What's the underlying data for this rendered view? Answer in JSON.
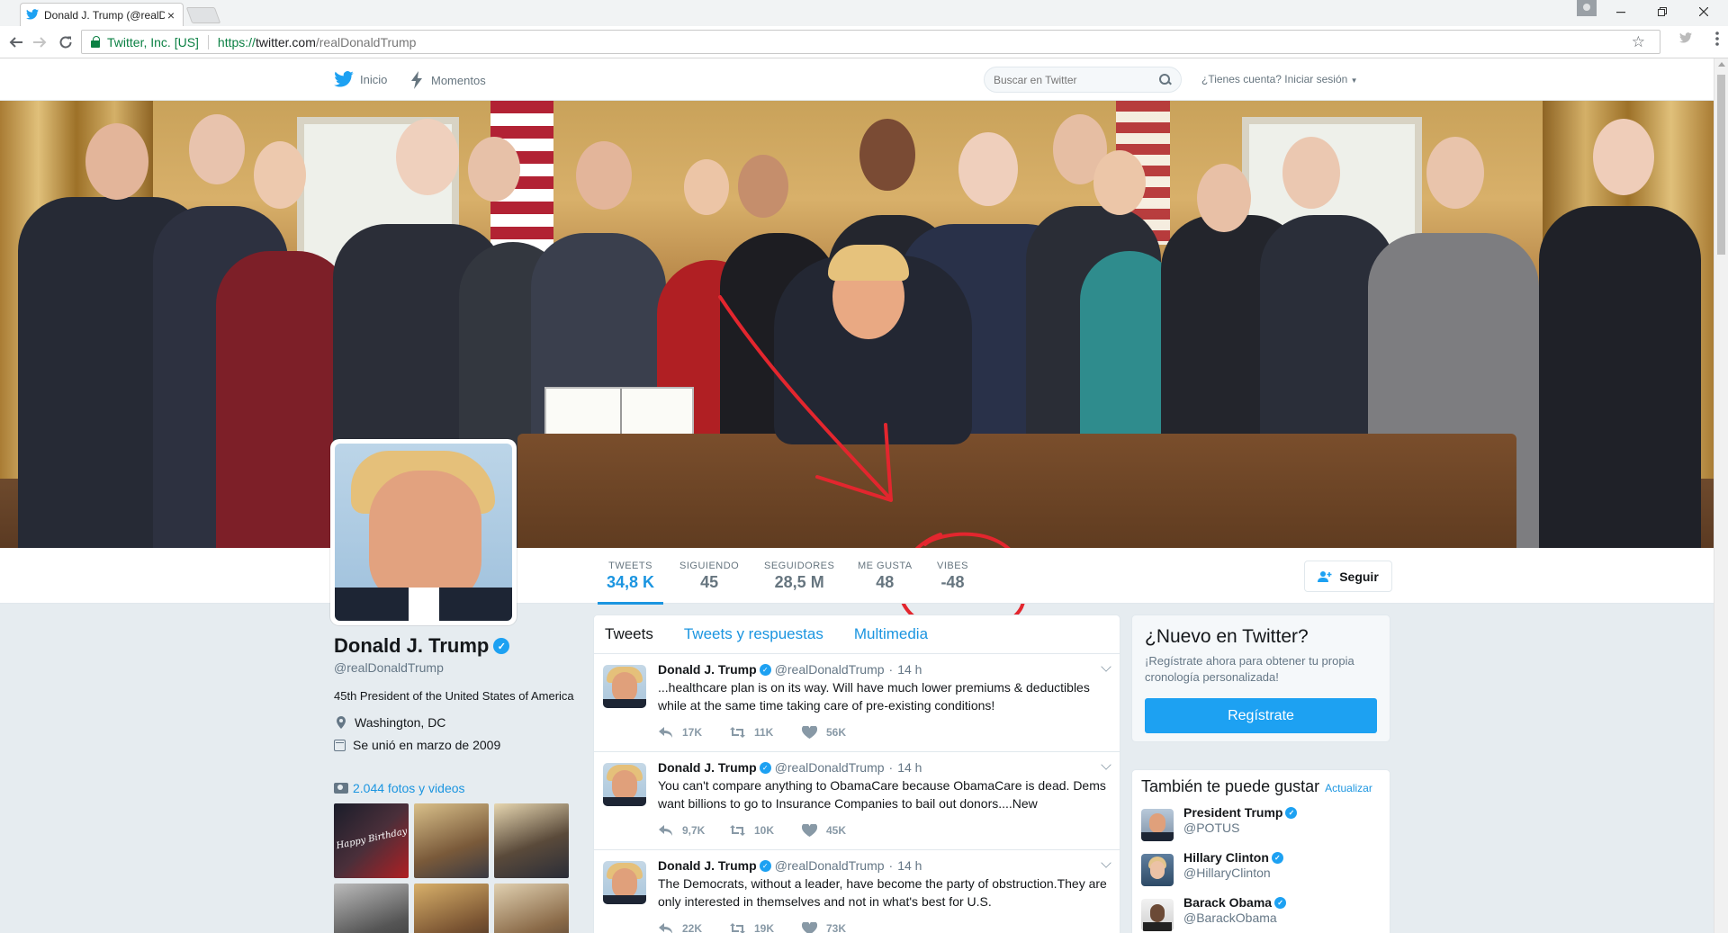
{
  "browser": {
    "tab_title": "Donald J. Trump (@realD",
    "tab_close": "×",
    "omnibox": {
      "org": "Twitter, Inc. [US]",
      "scheme": "https://",
      "host": "twitter.com",
      "path": "/realDonaldTrump"
    }
  },
  "topnav": {
    "home_label": "Inicio",
    "moments_label": "Momentos",
    "search_placeholder": "Buscar en Twitter",
    "login_label": "¿Tienes cuenta? Iniciar sesión",
    "brand_color": "#1da1f2"
  },
  "stats": [
    {
      "label": "TWEETS",
      "value": "34,8 K"
    },
    {
      "label": "SIGUIENDO",
      "value": "45"
    },
    {
      "label": "SEGUIDORES",
      "value": "28,5 M"
    },
    {
      "label": "ME GUSTA",
      "value": "48"
    },
    {
      "label": "VIBES",
      "value": "-48"
    }
  ],
  "follow_label": "Seguir",
  "profile": {
    "name": "Donald J. Trump",
    "screen_name": "@realDonaldTrump",
    "bio": "45th President of the United States of America",
    "location": "Washington, DC",
    "joined": "Se unió en marzo de 2009",
    "photos_label": "2.044 fotos y videos",
    "photo_thumb_text": "Happy Birthday"
  },
  "timeline": {
    "tabs": [
      "Tweets",
      "Tweets y respuestas",
      "Multimedia"
    ],
    "tweets": [
      {
        "name": "Donald J. Trump",
        "handle": "@realDonaldTrump",
        "time": "14 h",
        "text": "...healthcare plan is on its way. Will have much lower premiums & deductibles while at the same time taking care of pre-existing conditions!",
        "replies": "17K",
        "retweets": "11K",
        "likes": "56K"
      },
      {
        "name": "Donald J. Trump",
        "handle": "@realDonaldTrump",
        "time": "14 h",
        "text": "You can't compare anything to ObamaCare because ObamaCare is dead. Dems want billions to go to Insurance Companies to bail out donors....New",
        "replies": "9,7K",
        "retweets": "10K",
        "likes": "45K"
      },
      {
        "name": "Donald J. Trump",
        "handle": "@realDonaldTrump",
        "time": "14 h",
        "text": "The Democrats, without a leader, have become the party of obstruction.They are only interested in themselves and not in what's best for U.S.",
        "replies": "22K",
        "retweets": "19K",
        "likes": "73K"
      }
    ]
  },
  "signup": {
    "title": "¿Nuevo en Twitter?",
    "text": "¡Regístrate ahora para obtener tu propia cronología personalizada!",
    "button": "Regístrate"
  },
  "who_to_follow": {
    "title": "También te puede gustar",
    "refresh": "Actualizar",
    "items": [
      {
        "name": "President Trump",
        "handle": "@POTUS"
      },
      {
        "name": "Hillary Clinton",
        "handle": "@HillaryClinton"
      },
      {
        "name": "Barack Obama",
        "handle": "@BarackObama"
      }
    ]
  },
  "annotation_color": "#e3262e"
}
